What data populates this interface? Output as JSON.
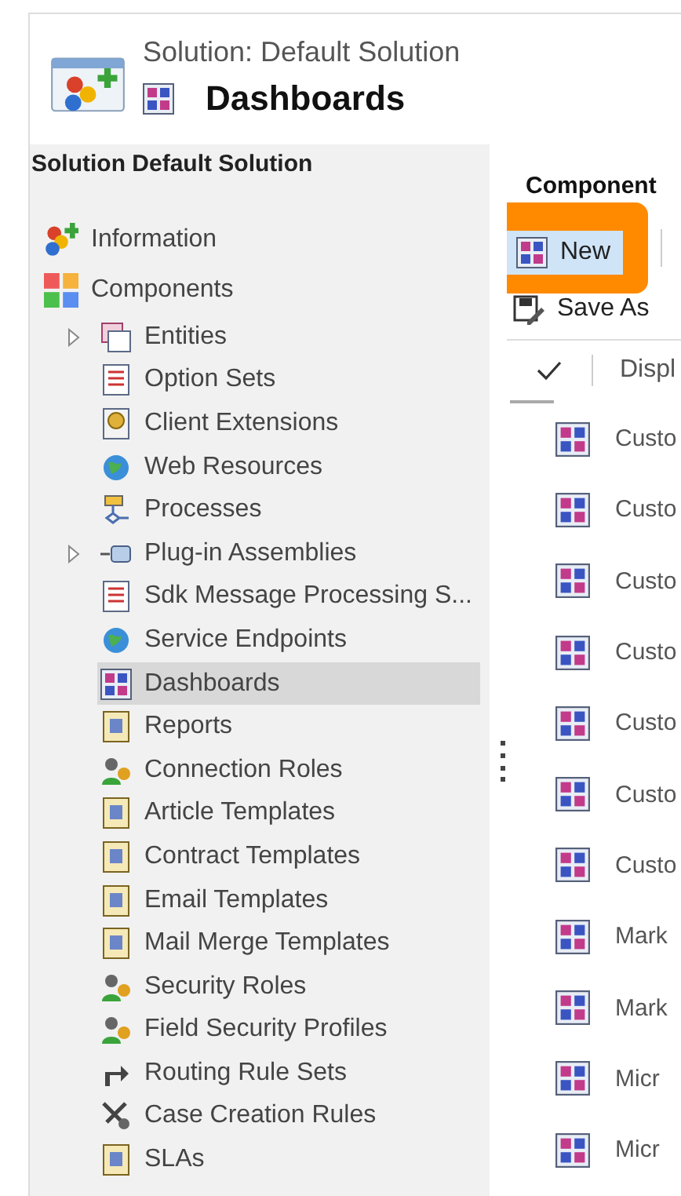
{
  "header": {
    "solution_title": "Solution: Default Solution",
    "page_title": "Dashboards"
  },
  "sidebar": {
    "heading": "Solution Default Solution",
    "items": [
      {
        "label": "Information",
        "selected": false
      },
      {
        "label": "Components",
        "selected": false,
        "children": [
          {
            "label": "Entities",
            "kind": "folder",
            "expanded": false,
            "selected": false
          },
          {
            "label": "Option Sets",
            "kind": "leaf",
            "selected": false
          },
          {
            "label": "Client Extensions",
            "kind": "leaf",
            "selected": false
          },
          {
            "label": "Web Resources",
            "kind": "leaf",
            "selected": false
          },
          {
            "label": "Processes",
            "kind": "leaf",
            "selected": false
          },
          {
            "label": "Plug-in Assemblies",
            "kind": "folder",
            "expanded": false,
            "selected": false
          },
          {
            "label": "Sdk Message Processing S...",
            "kind": "leaf",
            "selected": false
          },
          {
            "label": "Service Endpoints",
            "kind": "leaf",
            "selected": false
          },
          {
            "label": "Dashboards",
            "kind": "leaf",
            "selected": true
          },
          {
            "label": "Reports",
            "kind": "leaf",
            "selected": false
          },
          {
            "label": "Connection Roles",
            "kind": "leaf",
            "selected": false
          },
          {
            "label": "Article Templates",
            "kind": "leaf",
            "selected": false
          },
          {
            "label": "Contract Templates",
            "kind": "leaf",
            "selected": false
          },
          {
            "label": "Email Templates",
            "kind": "leaf",
            "selected": false
          },
          {
            "label": "Mail Merge Templates",
            "kind": "leaf",
            "selected": false
          },
          {
            "label": "Security Roles",
            "kind": "leaf",
            "selected": false
          },
          {
            "label": "Field Security Profiles",
            "kind": "leaf",
            "selected": false
          },
          {
            "label": "Routing Rule Sets",
            "kind": "leaf",
            "selected": false
          },
          {
            "label": "Case Creation Rules",
            "kind": "leaf",
            "selected": false
          },
          {
            "label": "SLAs",
            "kind": "leaf",
            "selected": false
          }
        ]
      }
    ]
  },
  "main": {
    "section_title": "Component",
    "toolbar": {
      "new_button": "New",
      "save_as_button": "Save As"
    },
    "table": {
      "columns": [
        "Displ"
      ],
      "rows": [
        {
          "name": "Custo"
        },
        {
          "name": "Custo"
        },
        {
          "name": "Custo"
        },
        {
          "name": "Custo"
        },
        {
          "name": "Custo"
        },
        {
          "name": "Custo"
        },
        {
          "name": "Custo"
        },
        {
          "name": "Mark"
        },
        {
          "name": "Mark"
        },
        {
          "name": "Micr"
        },
        {
          "name": "Micr"
        }
      ]
    }
  }
}
